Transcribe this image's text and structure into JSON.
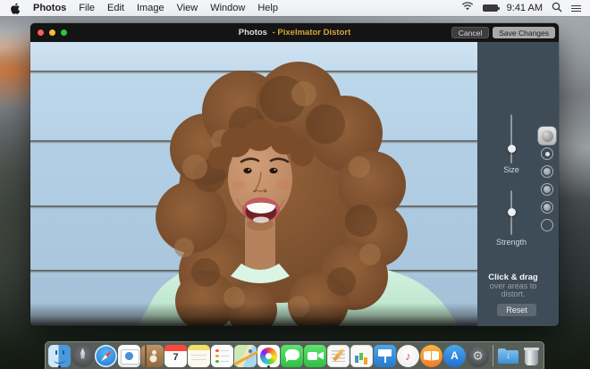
{
  "menu_bar": {
    "app_name": "Photos",
    "menus": [
      "File",
      "Edit",
      "Image",
      "View",
      "Window",
      "Help"
    ],
    "status": {
      "time": "9:41 AM"
    },
    "icons": [
      "apple-logo",
      "wifi",
      "battery",
      "spotlight-search",
      "notification-center"
    ]
  },
  "window": {
    "title": {
      "app": "Photos",
      "separator": "-",
      "document": "Pixelmator Distort"
    },
    "toolbar": {
      "cancel_label": "Cancel",
      "save_label": "Save Changes"
    },
    "sidebar": {
      "size_label": "Size",
      "strength_label": "Strength",
      "hint": {
        "line1": "Click & drag",
        "line2": "over areas to",
        "line3": "distort."
      },
      "reset_label": "Reset",
      "tools": [
        "bump-tool",
        "pinch-tool",
        "twirl-left-tool",
        "twirl-right-tool",
        "warp-tool",
        "restore-tool"
      ],
      "selected_tool_index": 0,
      "size_thumb_pct_from_top": 71,
      "strength_thumb_pct_from_top": 50
    },
    "photo_alt": "Laughing woman with voluminous curly brown hair wearing a mint green shirt in front of light blue wooden siding"
  },
  "dock": {
    "items": [
      "Finder",
      "Launchpad",
      "Safari",
      "Mail",
      "Contacts",
      "Calendar",
      "Notes",
      "Reminders",
      "Maps",
      "Photos",
      "Messages",
      "FaceTime",
      "Pages",
      "Numbers",
      "Keynote",
      "iTunes",
      "iBooks",
      "App Store",
      "System Preferences",
      "Downloads",
      "Trash"
    ],
    "calendar_day": "7",
    "appstore_letter": "A",
    "itunes_glyph": "♪",
    "sysprefs_glyph": "⚙",
    "downloads_glyph": "↓",
    "running_apps": [
      "Finder",
      "Photos"
    ]
  },
  "colors": {
    "accent-title": "#d9a43b",
    "menubar-bg": "#f4f5f6",
    "titlebar-bg": "#141414",
    "sidebar-bg": "#3e4c58",
    "siding": "#bcd7ea",
    "shirt-mint": "#c9ecd7",
    "hair-brown": "#84552f",
    "skin": "#c79470",
    "traffic-red": "#ff5f57",
    "traffic-yellow": "#febc2e",
    "traffic-green": "#28c840"
  }
}
